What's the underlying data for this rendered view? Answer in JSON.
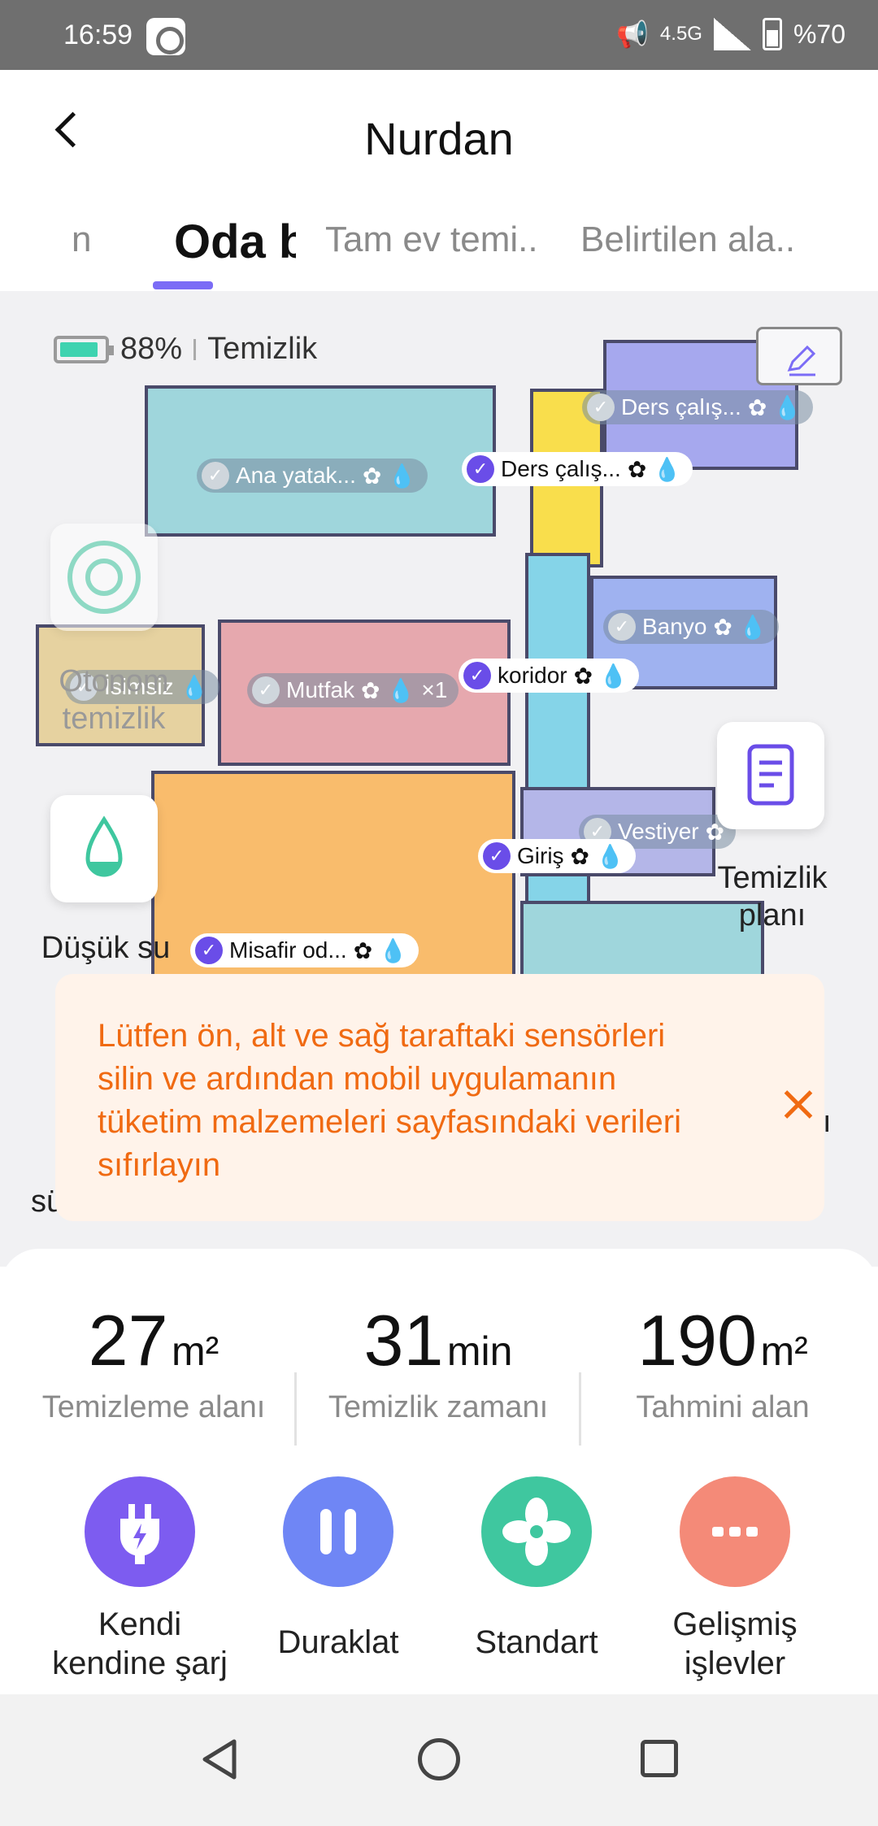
{
  "status_bar": {
    "time": "16:59",
    "network": "4.5G",
    "battery": "%70"
  },
  "header": {
    "title": "Nurdan"
  },
  "tabs": [
    {
      "label": "n"
    },
    {
      "label": "Oda b"
    },
    {
      "label": "Tam ev temi.."
    },
    {
      "label": "Belirtilen ala.."
    }
  ],
  "map": {
    "battery_percent": "88%",
    "status": "Temizlik",
    "rooms": [
      {
        "label": "Ana yatak...",
        "selected": false
      },
      {
        "label": "Ders çalış...",
        "selected": true
      },
      {
        "label": "Ders çalış...",
        "selected": false
      },
      {
        "label": "Banyo",
        "selected": false
      },
      {
        "label": "koridor",
        "selected": true
      },
      {
        "label": "Mutfak",
        "selected": false,
        "extra": "×1"
      },
      {
        "label": "İsimsiz",
        "selected": false
      },
      {
        "label": "Vestiyer",
        "selected": false
      },
      {
        "label": "Giriş",
        "selected": true
      },
      {
        "label": "Misafir od...",
        "selected": true
      }
    ],
    "side_buttons": {
      "auto_label": "Otonom temizlik",
      "water_label": "Düşük su",
      "plan_label": "Temizlik planı",
      "partial_left": "sü",
      "partial_right": "ı"
    }
  },
  "toast": {
    "message": "Lütfen ön, alt ve sağ taraftaki sensörleri silin ve ardından mobil uygulamanın tüketim malzemeleri sayfasındaki verileri sıfırlayın"
  },
  "stats": [
    {
      "value": "27",
      "unit": "m²",
      "label": "Temizleme alanı"
    },
    {
      "value": "31",
      "unit": "min",
      "label": "Temizlik zamanı"
    },
    {
      "value": "190",
      "unit": "m²",
      "label": "Tahmini alan"
    }
  ],
  "actions": [
    {
      "label": "Kendi kendine şarj",
      "color": "#7d5cf0"
    },
    {
      "label": "Duraklat",
      "color": "#6f86f5"
    },
    {
      "label": "Standart",
      "color": "#3fc79f"
    },
    {
      "label": "Gelişmiş işlevler",
      "color": "#f48a78"
    }
  ],
  "colors": {
    "accent": "#7b6cf6",
    "toast_text": "#f06a12",
    "toast_bg": "#fff3ea"
  }
}
